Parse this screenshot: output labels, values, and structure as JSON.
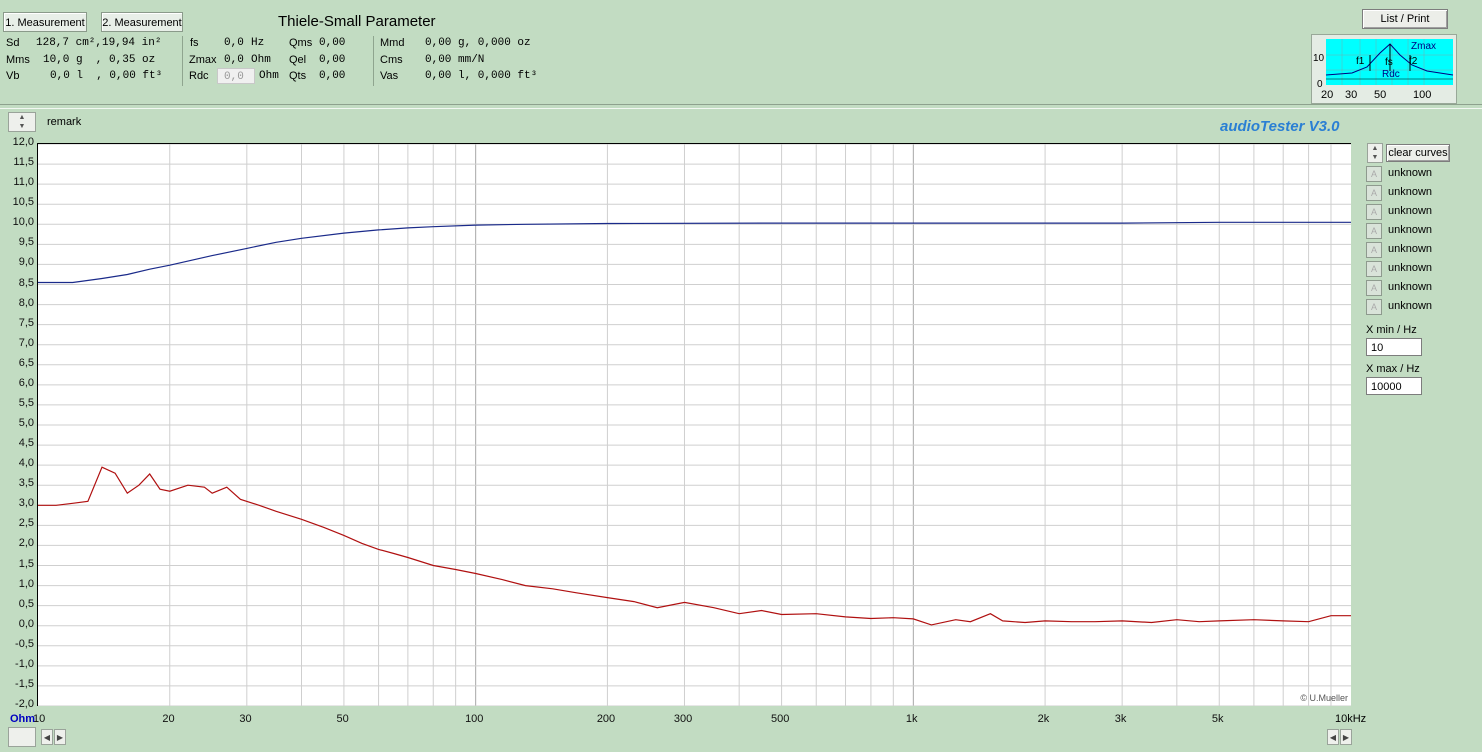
{
  "tabs": [
    {
      "label": "1. Measurement"
    },
    {
      "label": "2. Measurement"
    }
  ],
  "ts_title": "Thiele-Small Parameter",
  "params": {
    "col1": [
      {
        "label": "Sd",
        "value": "128,7 cm²,19,94 in²"
      },
      {
        "label": "Mms",
        "value": "10,0 g  , 0,35 oz"
      },
      {
        "label": "Vb",
        "value": "0,0 l  , 0,00 ft³"
      }
    ],
    "col2": [
      {
        "label": "fs",
        "value": "0,0",
        "unit": "Hz"
      },
      {
        "label": "Zmax",
        "value": "0,0",
        "unit": "Ohm"
      },
      {
        "label": "Rdc",
        "value": "0,0",
        "unit": "Ohm"
      }
    ],
    "col3": [
      {
        "label": "Qms",
        "value": "0,00"
      },
      {
        "label": "Qel",
        "value": "0,00"
      },
      {
        "label": "Qts",
        "value": "0,00"
      }
    ],
    "col4": [
      {
        "label": "Mmd",
        "value": "0,00 g, 0,000 oz"
      },
      {
        "label": "Cms",
        "value": "0,00 mm/N"
      },
      {
        "label": "Vas",
        "value": "0,00 l, 0,000 ft³"
      }
    ]
  },
  "list_print_label": "List / Print",
  "mini_chart": {
    "y_top": "10",
    "y_bottom": "0",
    "x_ticks": [
      "20",
      "30",
      "50",
      "100"
    ],
    "labels": {
      "zmax": "Zmax",
      "f1": "f1",
      "fs": "fs",
      "f2": "f2",
      "rdc": "Rdc"
    }
  },
  "remark_label": "remark",
  "brand": "audioTester  V3.0",
  "copyright": "© U.Mueller",
  "y_unit": "Ohm",
  "x_unit_end": "10kHz",
  "clear_curves_label": "clear curves",
  "legend": [
    "unknown",
    "unknown",
    "unknown",
    "unknown",
    "unknown",
    "unknown",
    "unknown",
    "unknown"
  ],
  "legend_box_glyph": "A",
  "xmin_label": "X min / Hz",
  "xmin_value": "10",
  "xmax_label": "X max / Hz",
  "xmax_value": "10000",
  "colors": {
    "background": "#c2dcc2",
    "grid": "#c0c0c0",
    "series_blue": "#1a2a8a",
    "series_red": "#b01010",
    "brand": "#2a7fd4"
  },
  "icons": {
    "spin": "spin-up-down-icon",
    "scroll_left": "arrow-left-icon",
    "scroll_right": "arrow-right-icon"
  },
  "chart_data": {
    "type": "line",
    "x_scale": "log",
    "xlim": [
      10,
      10000
    ],
    "ylim": [
      -2.0,
      12.0
    ],
    "ylabel": "Ohm",
    "y_ticks": [
      "12,0",
      "11,5",
      "11,0",
      "10,5",
      "10,0",
      "9,5",
      "9,0",
      "8,5",
      "8,0",
      "7,5",
      "7,0",
      "6,5",
      "6,0",
      "5,5",
      "5,0",
      "4,5",
      "4,0",
      "3,5",
      "3,0",
      "2,5",
      "2,0",
      "1,5",
      "1,0",
      "0,5",
      "0,0",
      "-0,5",
      "-1,0",
      "-1,5",
      "-2,0"
    ],
    "x_ticks": [
      {
        "v": 10,
        "label": "10"
      },
      {
        "v": 20,
        "label": "20"
      },
      {
        "v": 30,
        "label": "30"
      },
      {
        "v": 50,
        "label": "50"
      },
      {
        "v": 100,
        "label": "100"
      },
      {
        "v": 200,
        "label": "200"
      },
      {
        "v": 300,
        "label": "300"
      },
      {
        "v": 500,
        "label": "500"
      },
      {
        "v": 1000,
        "label": "1k"
      },
      {
        "v": 2000,
        "label": "2k"
      },
      {
        "v": 3000,
        "label": "3k"
      },
      {
        "v": 5000,
        "label": "5k"
      },
      {
        "v": 10000,
        "label": ""
      }
    ],
    "grid": true,
    "series": [
      {
        "color": "#1a2a8a",
        "points": [
          [
            10,
            8.55
          ],
          [
            12,
            8.55
          ],
          [
            14,
            8.65
          ],
          [
            16,
            8.75
          ],
          [
            18,
            8.88
          ],
          [
            20,
            8.98
          ],
          [
            25,
            9.22
          ],
          [
            30,
            9.4
          ],
          [
            35,
            9.55
          ],
          [
            40,
            9.65
          ],
          [
            50,
            9.78
          ],
          [
            60,
            9.86
          ],
          [
            70,
            9.91
          ],
          [
            80,
            9.94
          ],
          [
            100,
            9.98
          ],
          [
            130,
            10.0
          ],
          [
            200,
            10.02
          ],
          [
            500,
            10.03
          ],
          [
            1000,
            10.03
          ],
          [
            3000,
            10.03
          ],
          [
            5000,
            10.05
          ],
          [
            10000,
            10.05
          ]
        ]
      },
      {
        "color": "#b01010",
        "points": [
          [
            10,
            3.0
          ],
          [
            11,
            3.0
          ],
          [
            12,
            3.05
          ],
          [
            13,
            3.1
          ],
          [
            14,
            3.95
          ],
          [
            15,
            3.8
          ],
          [
            16,
            3.3
          ],
          [
            17,
            3.5
          ],
          [
            18,
            3.78
          ],
          [
            19,
            3.4
          ],
          [
            20,
            3.35
          ],
          [
            22,
            3.5
          ],
          [
            24,
            3.45
          ],
          [
            25,
            3.3
          ],
          [
            27,
            3.45
          ],
          [
            29,
            3.15
          ],
          [
            32,
            3.0
          ],
          [
            35,
            2.85
          ],
          [
            40,
            2.65
          ],
          [
            45,
            2.45
          ],
          [
            50,
            2.25
          ],
          [
            55,
            2.05
          ],
          [
            60,
            1.9
          ],
          [
            65,
            1.8
          ],
          [
            70,
            1.7
          ],
          [
            80,
            1.5
          ],
          [
            90,
            1.4
          ],
          [
            100,
            1.3
          ],
          [
            115,
            1.15
          ],
          [
            130,
            1.0
          ],
          [
            150,
            0.92
          ],
          [
            170,
            0.82
          ],
          [
            200,
            0.7
          ],
          [
            230,
            0.6
          ],
          [
            260,
            0.45
          ],
          [
            300,
            0.58
          ],
          [
            350,
            0.45
          ],
          [
            400,
            0.3
          ],
          [
            450,
            0.38
          ],
          [
            500,
            0.28
          ],
          [
            600,
            0.3
          ],
          [
            700,
            0.22
          ],
          [
            800,
            0.18
          ],
          [
            900,
            0.2
          ],
          [
            1000,
            0.17
          ],
          [
            1100,
            0.02
          ],
          [
            1250,
            0.15
          ],
          [
            1350,
            0.1
          ],
          [
            1500,
            0.3
          ],
          [
            1600,
            0.12
          ],
          [
            1800,
            0.08
          ],
          [
            2000,
            0.12
          ],
          [
            2300,
            0.1
          ],
          [
            2600,
            0.1
          ],
          [
            3000,
            0.12
          ],
          [
            3500,
            0.08
          ],
          [
            4000,
            0.15
          ],
          [
            4500,
            0.1
          ],
          [
            5000,
            0.12
          ],
          [
            6000,
            0.15
          ],
          [
            7000,
            0.12
          ],
          [
            8000,
            0.1
          ],
          [
            9000,
            0.25
          ],
          [
            10000,
            0.25
          ]
        ]
      }
    ]
  }
}
